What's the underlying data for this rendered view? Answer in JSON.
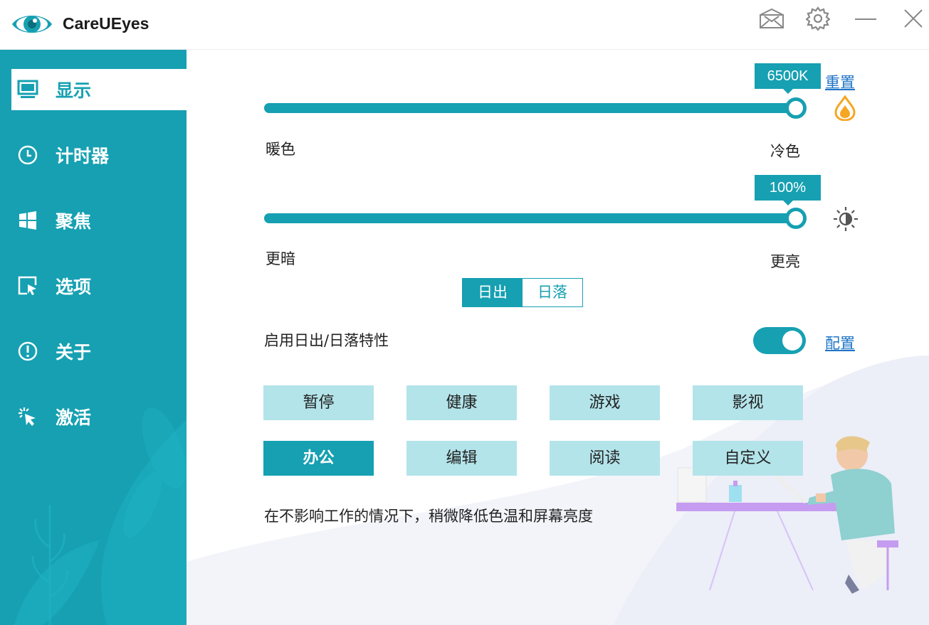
{
  "app": {
    "title": "CareUEyes",
    "logo_icon": "eye-icon"
  },
  "titlebar": {
    "buttons": [
      "mail-icon",
      "settings-gear-icon",
      "minimize-icon",
      "close-icon"
    ]
  },
  "colors": {
    "accent": "#16a0b2",
    "button_light": "#b3e4ea",
    "link": "#1f74c7",
    "temperature_icon": "#f5a623"
  },
  "sidebar": {
    "active_index": 0,
    "items": [
      {
        "label": "显示",
        "icon": "monitor-icon"
      },
      {
        "label": "计时器",
        "icon": "clock-icon"
      },
      {
        "label": "聚焦",
        "icon": "windows-icon"
      },
      {
        "label": "选项",
        "icon": "cursor-window-icon"
      },
      {
        "label": "关于",
        "icon": "info-icon"
      },
      {
        "label": "激活",
        "icon": "click-sparkle-icon"
      }
    ]
  },
  "display": {
    "color_temperature": {
      "value_label": "6500K",
      "level_fraction": 1.0,
      "min_label": "暖色",
      "max_label": "冷色",
      "reset_link": "重置",
      "icon": "water-drop-icon"
    },
    "brightness": {
      "value_label": "100%",
      "level_fraction": 1.0,
      "min_label": "更暗",
      "max_label": "更亮",
      "icon": "brightness-sun-icon"
    },
    "sun_tabs": {
      "selected": "日出",
      "options": [
        "日出",
        "日落"
      ]
    },
    "sunrise_sunset": {
      "label": "启用日出/日落特性",
      "enabled": true,
      "config_link": "配置"
    },
    "modes": {
      "selected": "办公",
      "row1": [
        "暂停",
        "健康",
        "游戏",
        "影视"
      ],
      "row2": [
        "办公",
        "编辑",
        "阅读",
        "自定义"
      ]
    },
    "description": "在不影响工作的情况下，稍微降低色温和屏幕亮度"
  }
}
